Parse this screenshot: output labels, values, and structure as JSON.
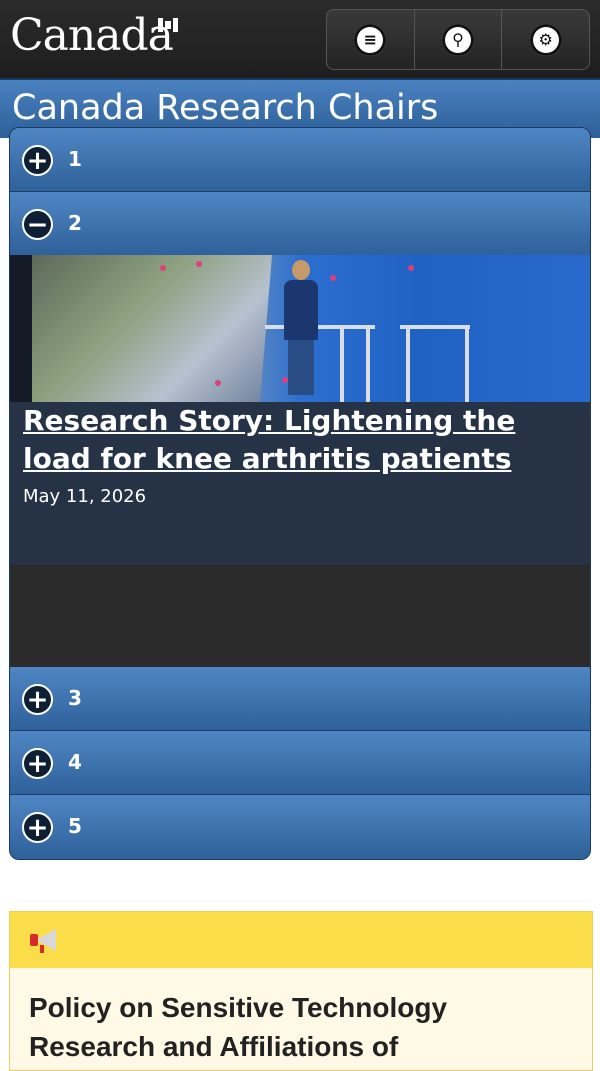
{
  "header": {
    "wordmark": "Canada",
    "buttons": [
      {
        "name": "menu",
        "icon": "menu-icon"
      },
      {
        "name": "search",
        "icon": "search-icon"
      },
      {
        "name": "settings",
        "icon": "gear-icon"
      }
    ]
  },
  "title": "Canada Research Chairs",
  "accordion": {
    "items": [
      {
        "label": "1",
        "expanded": false
      },
      {
        "label": "2",
        "expanded": true
      },
      {
        "label": "3",
        "expanded": false
      },
      {
        "label": "4",
        "expanded": false
      },
      {
        "label": "5",
        "expanded": false
      }
    ],
    "expanded_panel": {
      "image_alt_icon": "photo-of-treadmill-lab",
      "story_title": "Research Story: Lightening the load for knee arthritis patients",
      "date": "May 11, 2026"
    }
  },
  "notice": {
    "icon": "megaphone-icon",
    "heading": "Policy on Sensitive Technology Research and Affiliations of"
  },
  "colors": {
    "header_bg": "#232323",
    "title_bar": "#3a72b0",
    "notice_bar": "#fbdd49",
    "notice_bg": "#fff9e5"
  }
}
